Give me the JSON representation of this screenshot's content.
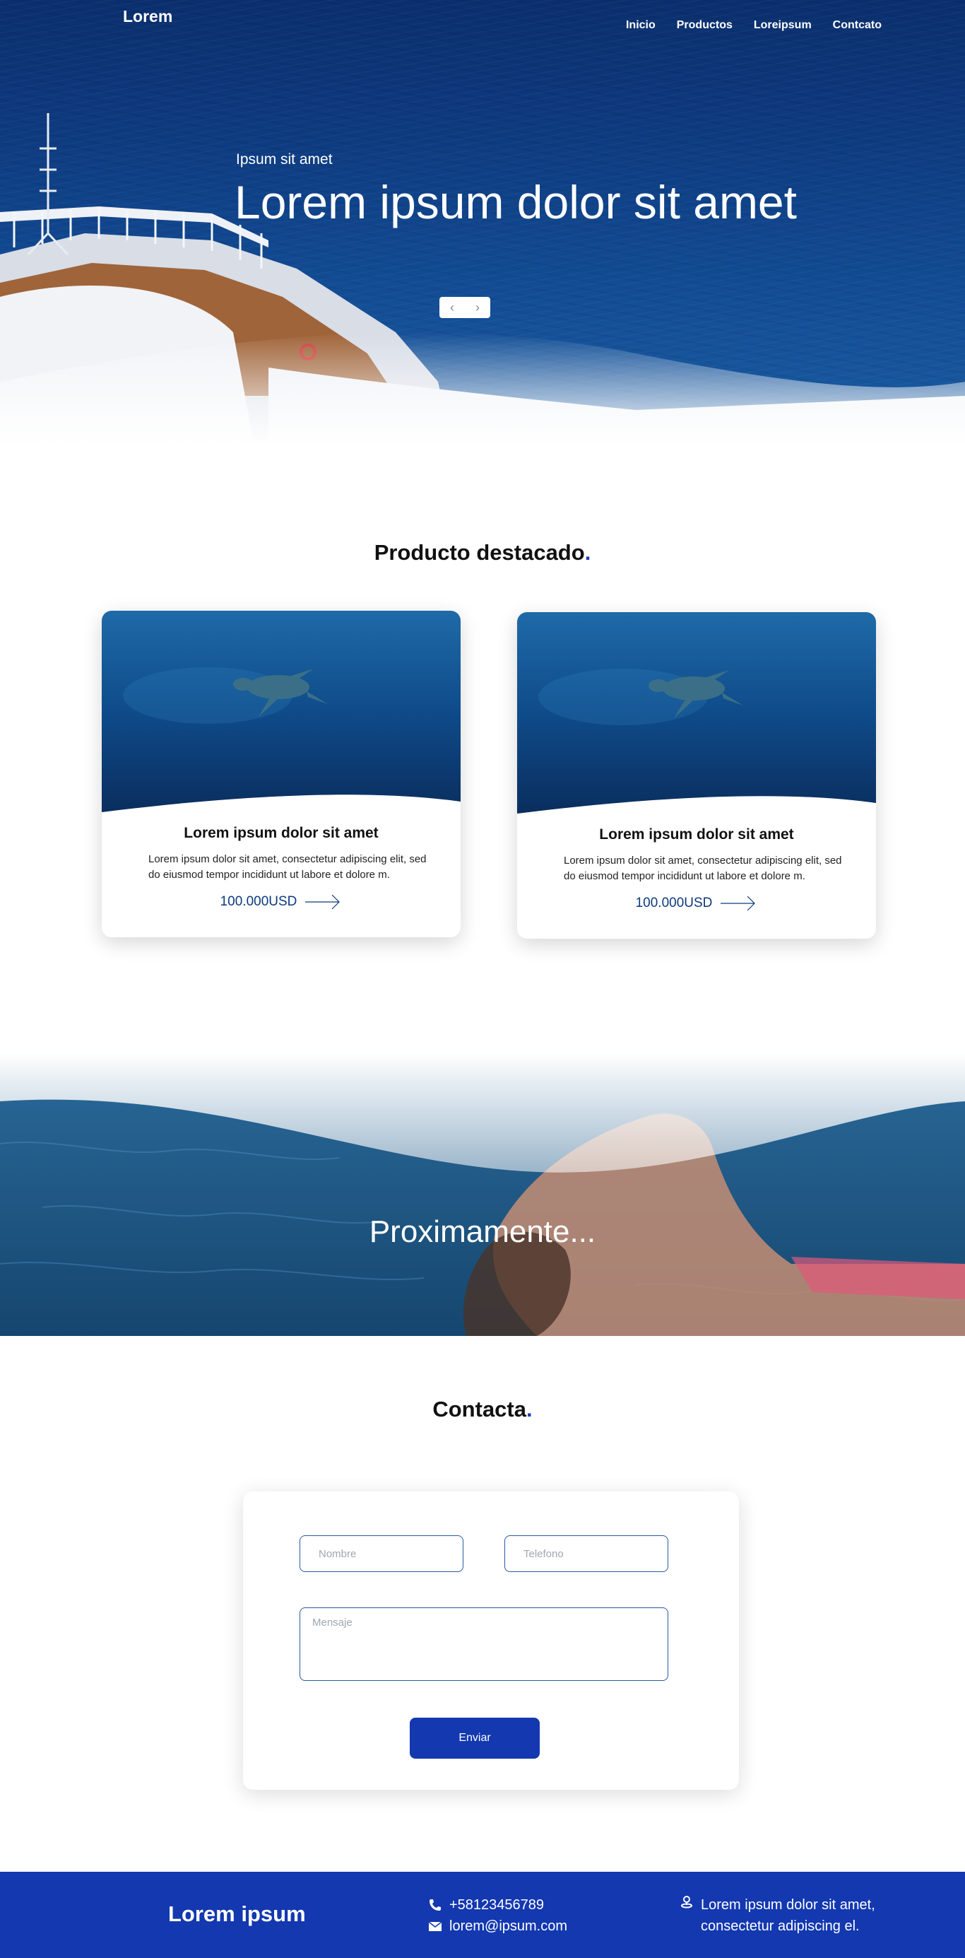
{
  "brand": "Lorem",
  "nav": {
    "items": [
      "Inicio",
      "Productos",
      "Loreipsum",
      "Contcato"
    ]
  },
  "hero": {
    "subtitle": "Ipsum sit amet",
    "title": "Lorem ipsum dolor sit amet",
    "prev_icon": "chevron-left-icon",
    "next_icon": "chevron-right-icon"
  },
  "featured": {
    "title": "Producto destacado",
    "title_dot": ".",
    "cards": [
      {
        "title": "Lorem ipsum dolor sit amet",
        "description": "Lorem ipsum dolor sit amet, consectetur adipiscing elit, sed do eiusmod tempor incididunt ut labore et dolore m.",
        "price": "100.000USD"
      },
      {
        "title": "Lorem ipsum dolor sit amet",
        "description": "Lorem ipsum dolor sit amet, consectetur adipiscing elit, sed do eiusmod tempor incididunt ut labore et dolore m.",
        "price": "100.000USD"
      }
    ]
  },
  "promo": {
    "text": "Proximamente..."
  },
  "contact": {
    "title": "Contacta",
    "title_dot": ".",
    "name_placeholder": "Nombre",
    "phone_placeholder": "Telefono",
    "message_placeholder": "Mensaje",
    "submit_label": "Enviar"
  },
  "footer": {
    "brand": "Lorem ipsum",
    "phone": "+58123456789",
    "email": "lorem@ipsum.com",
    "address_line1": "Lorem ipsum dolor sit amet,",
    "address_line2": "consectetur adipiscing el."
  },
  "colors": {
    "accent": "#1338b0",
    "price": "#0c3a7c",
    "ocean": "#0e3b80"
  }
}
